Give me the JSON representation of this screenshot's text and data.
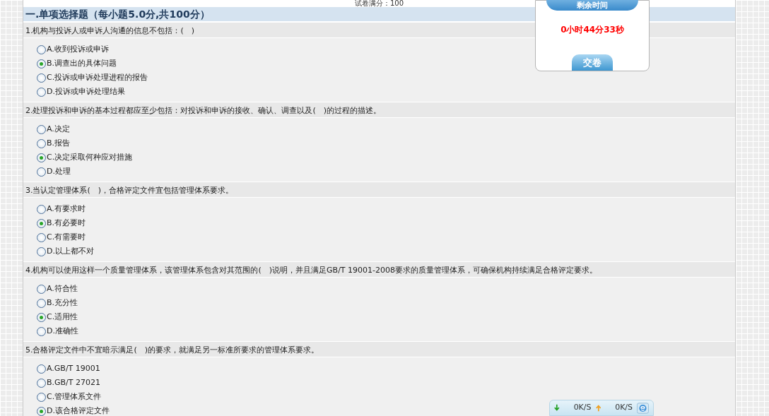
{
  "exam_total": "试卷满分：100",
  "section_title": "一.单项选择题（每小题5.0分,共100分）",
  "questions": [
    {
      "text": "1.机构与投诉人或申诉人沟通的信息不包括：(　)",
      "options": [
        {
          "label": "A.收到投诉或申诉",
          "selected": false
        },
        {
          "label": "B.调查出的具体问题",
          "selected": true
        },
        {
          "label": "C.投诉或申诉处理进程的报告",
          "selected": false
        },
        {
          "label": "D.投诉或申诉处理结果",
          "selected": false
        }
      ]
    },
    {
      "text": "2.处理投诉和申诉的基本过程都应至少包括：对投诉和申诉的接收、确认、调查以及(　)的过程的描述。",
      "options": [
        {
          "label": "A.决定",
          "selected": false
        },
        {
          "label": "B.报告",
          "selected": false
        },
        {
          "label": "C.决定采取何种应对措施",
          "selected": true
        },
        {
          "label": "D.处理",
          "selected": false
        }
      ]
    },
    {
      "text": "3.当认定管理体系(　)，合格评定文件宜包括管理体系要求。",
      "options": [
        {
          "label": "A.有要求时",
          "selected": false
        },
        {
          "label": "B.有必要时",
          "selected": true
        },
        {
          "label": "C.有需要时",
          "selected": false
        },
        {
          "label": "D.以上都不对",
          "selected": false
        }
      ]
    },
    {
      "text": "4.机构可以使用这样一个质量管理体系，该管理体系包含对其范围的(　)说明，并且满足GB/T 19001-2008要求的质量管理体系，可确保机构持续满足合格评定要求。",
      "options": [
        {
          "label": "A.符合性",
          "selected": false
        },
        {
          "label": "B.充分性",
          "selected": false
        },
        {
          "label": "C.适用性",
          "selected": true
        },
        {
          "label": "D.准确性",
          "selected": false
        }
      ]
    },
    {
      "text": "5.合格评定文件中不宜暗示满足(　)的要求，就满足另一标准所要求的管理体系要求。",
      "options": [
        {
          "label": "A.GB/T 19001",
          "selected": false
        },
        {
          "label": "B.GB/T 27021",
          "selected": false
        },
        {
          "label": "C.管理体系文件",
          "selected": false
        },
        {
          "label": "D.该合格评定文件",
          "selected": true
        }
      ]
    }
  ],
  "timer": {
    "title": "剩余时间",
    "remaining": "0小时44分33秒",
    "submit_button": "交卷"
  },
  "speed_bar": {
    "download": "0K/S",
    "upload": "0K/S"
  }
}
